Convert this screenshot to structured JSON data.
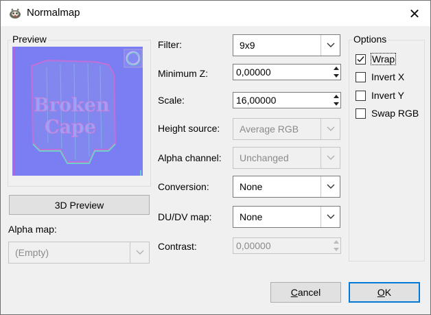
{
  "window": {
    "title": "Normalmap",
    "close_symbol": "✕"
  },
  "preview": {
    "group_label": "Preview",
    "image_text_line1": "Broken",
    "image_text_line2": "Cape",
    "button_label": "3D Preview"
  },
  "alpha_map": {
    "label": "Alpha map:",
    "value": "(Empty)"
  },
  "form": {
    "filter_label": "Filter:",
    "filter_value": "9x9",
    "min_z_label": "Minimum Z:",
    "min_z_value": "0,00000",
    "scale_label": "Scale:",
    "scale_value": "16,00000",
    "height_source_label": "Height source:",
    "height_source_value": "Average RGB",
    "alpha_channel_label": "Alpha channel:",
    "alpha_channel_value": "Unchanged",
    "conversion_label": "Conversion:",
    "conversion_value": "None",
    "dudv_label": "DU/DV map:",
    "dudv_value": "None",
    "contrast_label": "Contrast:",
    "contrast_value": "0,00000"
  },
  "options": {
    "group_label": "Options",
    "items": [
      {
        "label": "Wrap",
        "checked": true
      },
      {
        "label": "Invert X",
        "checked": false
      },
      {
        "label": "Invert Y",
        "checked": false
      },
      {
        "label": "Swap RGB",
        "checked": false
      }
    ]
  },
  "buttons": {
    "cancel_label_underline": "C",
    "cancel_label_rest": "ancel",
    "ok_label_underline": "O",
    "ok_label_rest": "K"
  },
  "colors": {
    "normal_map_base": "#7a7ef2",
    "normal_map_highlight": "#c060d0",
    "normal_map_shadow": "#6ed0c8",
    "accent": "#0078d7"
  }
}
